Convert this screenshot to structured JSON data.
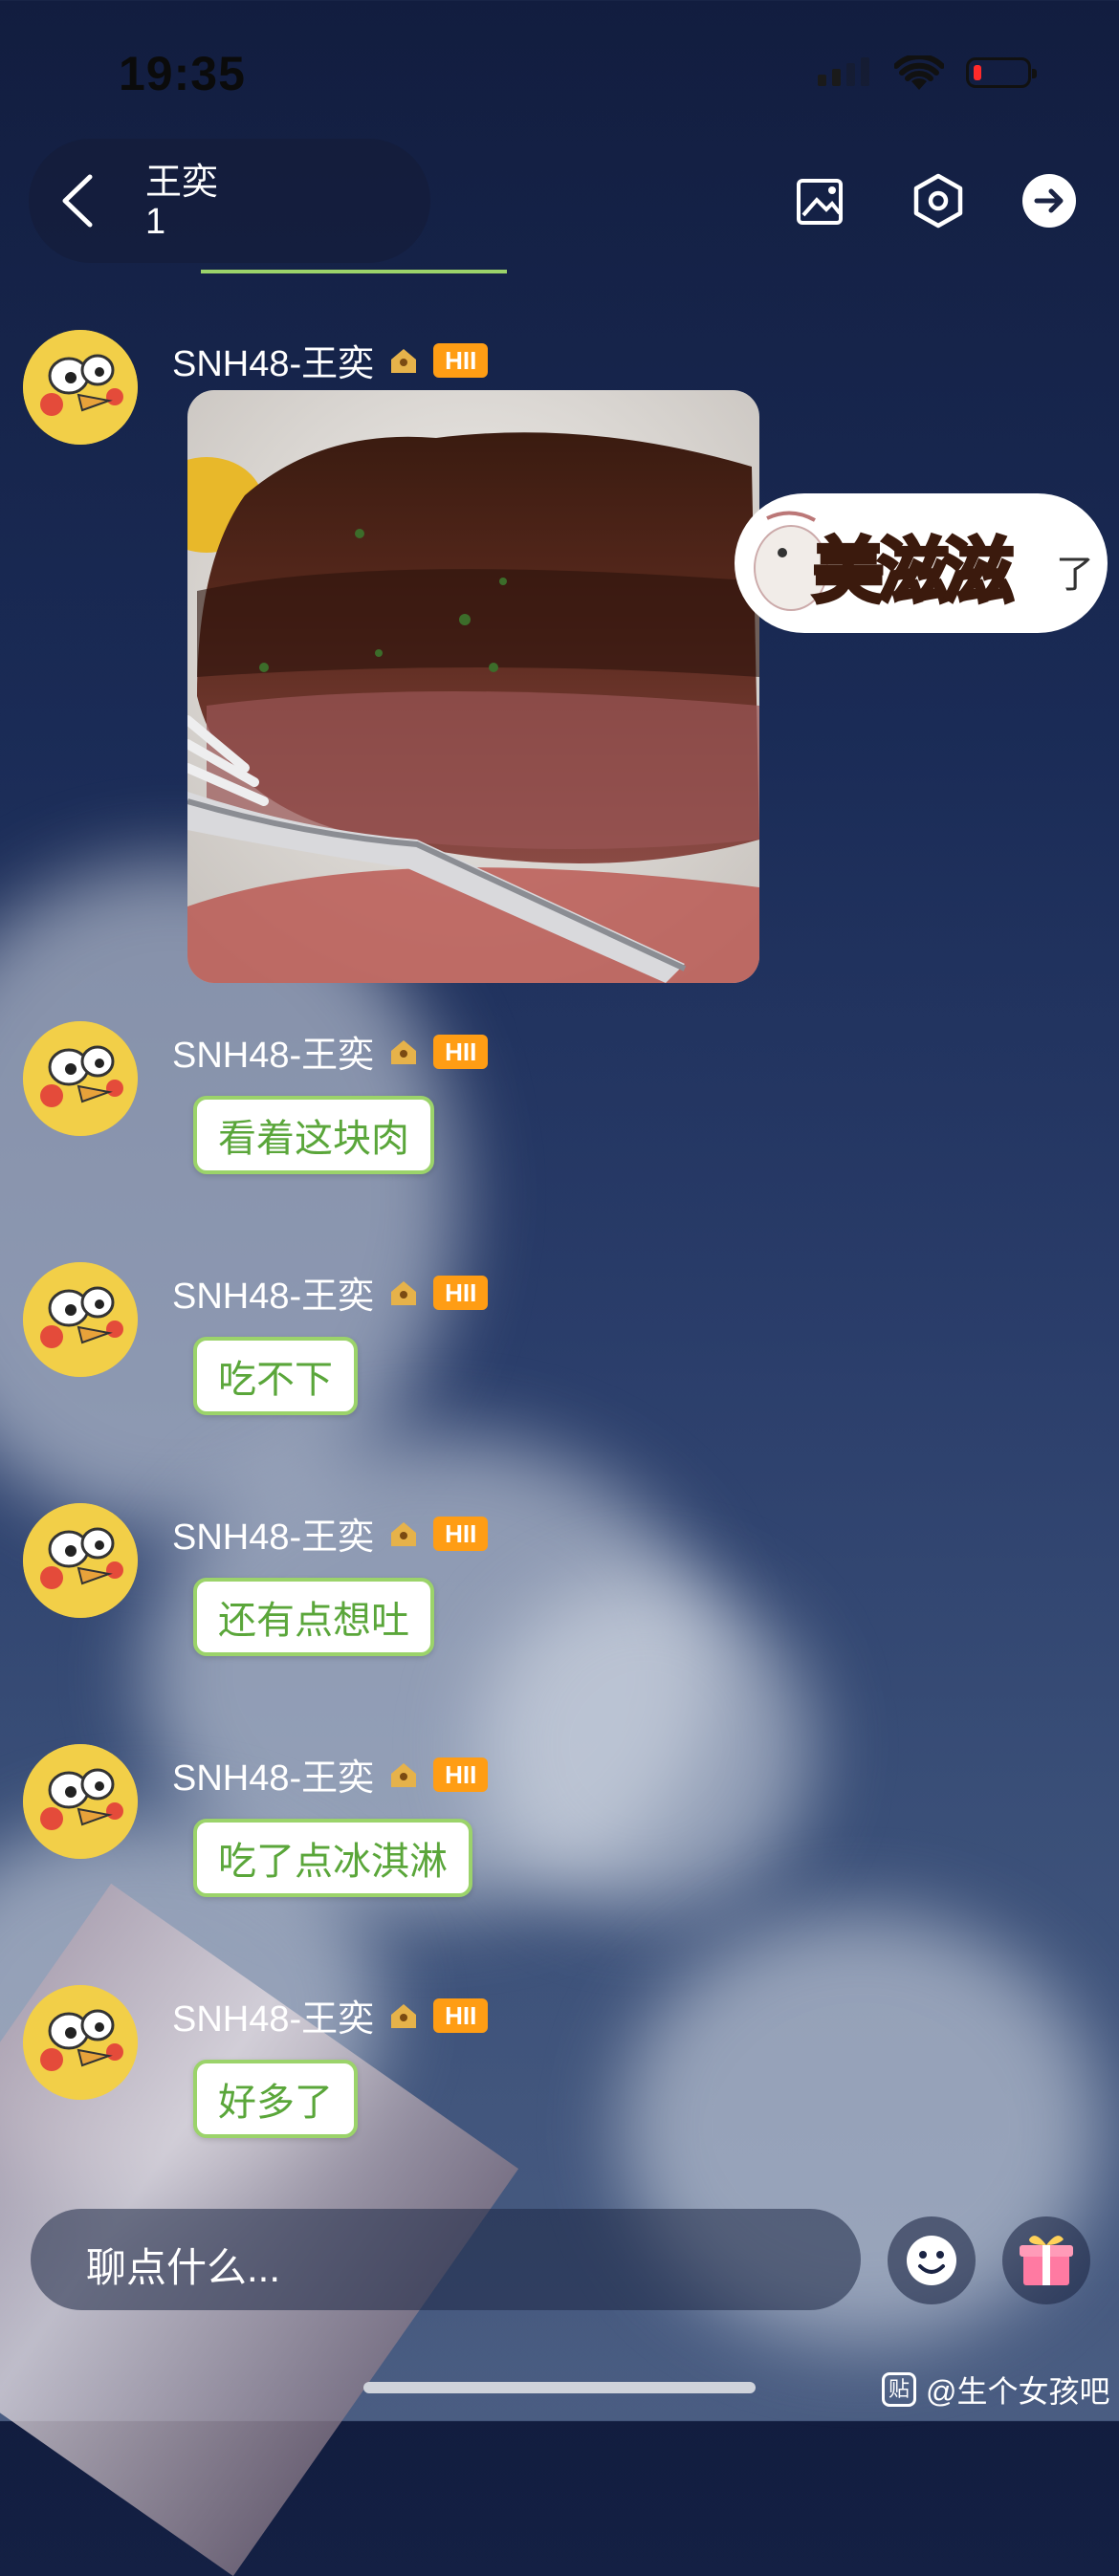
{
  "status_bar": {
    "time": "19:35"
  },
  "header": {
    "title": "王奕",
    "count": "1"
  },
  "messages": [
    {
      "sender": "SNH48-王奕",
      "level": "HII",
      "type": "image"
    },
    {
      "sender": "SNH48-王奕",
      "level": "HII",
      "text": "看着这块肉"
    },
    {
      "sender": "SNH48-王奕",
      "level": "HII",
      "text": "吃不下"
    },
    {
      "sender": "SNH48-王奕",
      "level": "HII",
      "text": "还有点想吐"
    },
    {
      "sender": "SNH48-王奕",
      "level": "HII",
      "text": "吃了点冰淇淋"
    },
    {
      "sender": "SNH48-王奕",
      "level": "HII",
      "text": "好多了"
    }
  ],
  "sticker": {
    "text": "美滋滋",
    "tail": "了"
  },
  "input": {
    "placeholder": "聊点什么..."
  },
  "watermark": {
    "icon": "贴",
    "text": "@生个女孩吧"
  },
  "icons": {
    "back": "chevron-left-icon",
    "gallery": "image-icon",
    "settings": "hexagon-settings-icon",
    "share": "arrow-right-circle-icon",
    "emoji": "emoji-icon",
    "gift": "gift-icon"
  },
  "colors": {
    "level_badge": "#ff9d14",
    "bubble_text": "#5aa63a",
    "bubble_border": "#9bd36a"
  }
}
